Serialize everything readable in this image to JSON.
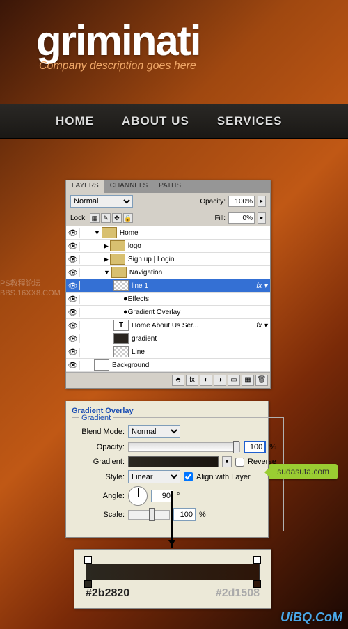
{
  "logo": {
    "title": "griminati",
    "tagline": "Company description goes here"
  },
  "nav": {
    "items": [
      "HOME",
      "ABOUT US",
      "SERVICES"
    ]
  },
  "layers_panel": {
    "tabs": [
      "LAYERS",
      "CHANNELS",
      "PATHS"
    ],
    "blend_mode": "Normal",
    "opacity_label": "Opacity:",
    "opacity_value": "100%",
    "lock_label": "Lock:",
    "fill_label": "Fill:",
    "fill_value": "0%",
    "layers": [
      {
        "eye": true,
        "indent": 0,
        "type": "folder",
        "name": "Home",
        "open": true
      },
      {
        "eye": true,
        "indent": 1,
        "type": "folder",
        "name": "logo",
        "open": false
      },
      {
        "eye": true,
        "indent": 1,
        "type": "folder",
        "name": "Sign up  |  Login",
        "open": false
      },
      {
        "eye": true,
        "indent": 1,
        "type": "folder",
        "name": "Navigation",
        "open": true
      },
      {
        "eye": true,
        "indent": 2,
        "type": "layer",
        "name": "line 1",
        "sel": true,
        "fx": true,
        "thumb": "checker"
      },
      {
        "eye": true,
        "indent": 3,
        "type": "fx",
        "name": "Effects"
      },
      {
        "eye": true,
        "indent": 3,
        "type": "fx",
        "name": "Gradient Overlay"
      },
      {
        "eye": true,
        "indent": 2,
        "type": "text",
        "name": "Home    About Us    Ser...",
        "fx": true
      },
      {
        "eye": true,
        "indent": 2,
        "type": "layer",
        "name": "gradient",
        "thumb": "dark"
      },
      {
        "eye": true,
        "indent": 2,
        "type": "layer",
        "name": "Line",
        "thumb": "checker"
      },
      {
        "eye": true,
        "indent": 0,
        "type": "layer",
        "name": "Background",
        "thumb": "white"
      }
    ]
  },
  "watermark1": {
    "l1": "PS教程论坛",
    "l2": "BBS.16XX8.COM"
  },
  "gradient_dialog": {
    "title": "Gradient Overlay",
    "legend": "Gradient",
    "blend_label": "Blend Mode:",
    "blend_value": "Normal",
    "opacity_label": "Opacity:",
    "opacity_value": "100",
    "pct": "%",
    "gradient_label": "Gradient:",
    "reverse_label": "Reverse",
    "style_label": "Style:",
    "style_value": "Linear",
    "align_label": "Align with Layer",
    "angle_label": "Angle:",
    "angle_value": "90",
    "deg": "°",
    "scale_label": "Scale:",
    "scale_value": "100"
  },
  "callout": "sudasuta.com",
  "gradient_editor": {
    "hex_left": "#2b2820",
    "hex_right": "#2d1508"
  },
  "watermark2": "UiBQ.CoM"
}
